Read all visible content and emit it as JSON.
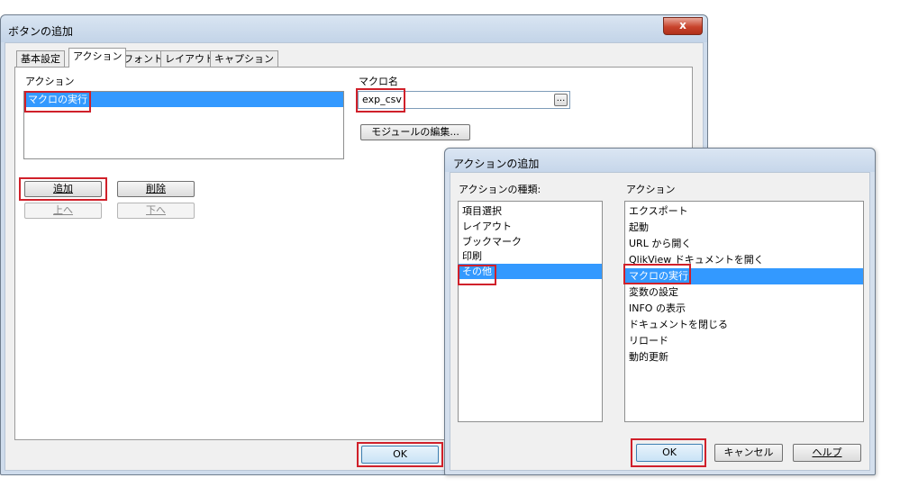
{
  "main_dialog": {
    "title": "ボタンの追加",
    "close_label": "x",
    "tabs": [
      {
        "label": "基本設定",
        "active": false
      },
      {
        "label": "アクション",
        "active": true
      },
      {
        "label": "フォント",
        "active": false
      },
      {
        "label": "レイアウト",
        "active": false
      },
      {
        "label": "キャプション",
        "active": false
      }
    ],
    "actions_label": "アクション",
    "actions_list": [
      "マクロの実行"
    ],
    "macro_name_label": "マクロ名",
    "macro_name_value": "exp_csv",
    "browse_label": "...",
    "edit_module_button": "モジュールの編集...",
    "add_button": "追加",
    "delete_button": "削除",
    "up_button": "上へ",
    "down_button": "下へ",
    "ok_button": "OK"
  },
  "add_action_dialog": {
    "title": "アクションの追加",
    "type_label": "アクションの種類:",
    "types": [
      "項目選択",
      "レイアウト",
      "ブックマーク",
      "印刷",
      "その他"
    ],
    "selected_type": "その他",
    "action_label": "アクション",
    "actions": [
      "エクスポート",
      "起動",
      "URL から開く",
      "QlikView ドキュメントを開く",
      "マクロの実行",
      "変数の設定",
      "INFO の表示",
      "ドキュメントを閉じる",
      "リロード",
      "動的更新"
    ],
    "selected_action": "マクロの実行",
    "ok_button": "OK",
    "cancel_button": "キャンセル",
    "help_button": "ヘルプ"
  },
  "colors": {
    "selection": "#3399ff",
    "highlight_box": "#d0202a",
    "titlebar": "#c3d4e8"
  }
}
